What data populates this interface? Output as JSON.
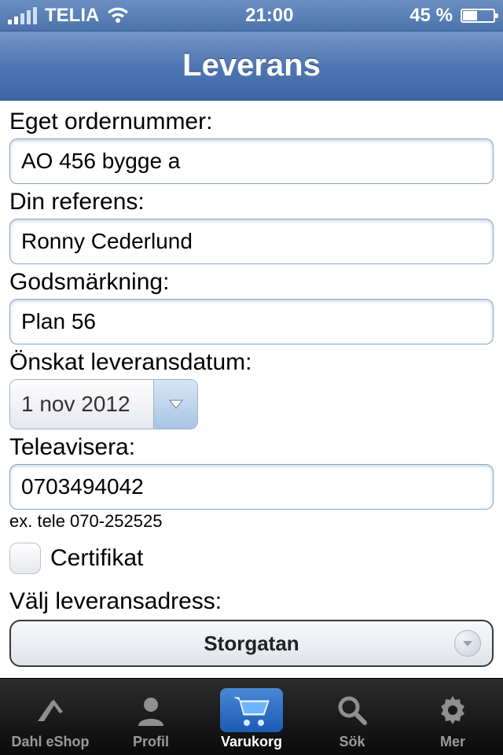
{
  "statusbar": {
    "carrier": "TELIA",
    "time": "21:00",
    "battery_text": "45 %"
  },
  "titlebar": {
    "title": "Leverans"
  },
  "form": {
    "order_label": "Eget ordernummer:",
    "order_value": "AO 456 bygge a",
    "ref_label": "Din referens:",
    "ref_value": "Ronny Cederlund",
    "mark_label": "Godsmärkning:",
    "mark_value": "Plan 56",
    "date_label": "Önskat leveransdatum:",
    "date_value": "1 nov 2012",
    "tele_label": "Teleavisera:",
    "tele_value": "0703494042",
    "tele_hint": "ex. tele 070-252525",
    "cert_label": "Certifikat",
    "addr_label": "Välj leveransadress:",
    "addr_value": "Storgatan"
  },
  "tabs": {
    "eshop": "Dahl eShop",
    "profile": "Profil",
    "cart": "Varukorg",
    "search": "Sök",
    "more": "Mer"
  }
}
